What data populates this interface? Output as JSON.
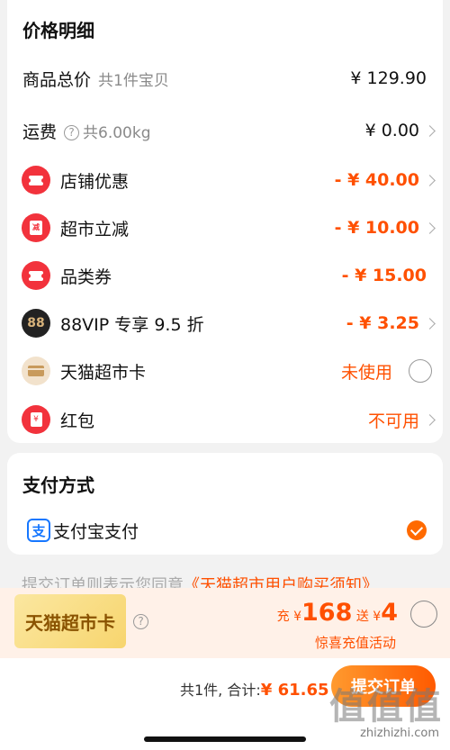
{
  "price_card": {
    "title": "价格明细",
    "rows": [
      {
        "label": "商品总价",
        "sub": "共1件宝贝",
        "value": "¥ 129.90"
      },
      {
        "label": "运费",
        "sub": "共6.00kg",
        "value": "¥ 0.00"
      },
      {
        "label": "店铺优惠",
        "value": "- ¥ 40.00",
        "icon": "shop-coupon-icon"
      },
      {
        "label": "超市立减",
        "value": "- ¥ 10.00",
        "icon": "supermarket-discount-icon",
        "icon_text": "减"
      },
      {
        "label": "品类券",
        "value": "- ¥ 15.00",
        "icon": "category-coupon-icon"
      },
      {
        "label": "88VIP 专享 9.5 折",
        "value": "- ¥ 3.25",
        "icon": "88vip-icon",
        "icon_text": "88"
      },
      {
        "label": "天猫超市卡",
        "value": "未使用",
        "icon": "tmall-card-icon"
      },
      {
        "label": "红包",
        "value": "不可用",
        "icon": "red-packet-icon",
        "icon_text": "¥"
      }
    ]
  },
  "payment": {
    "title": "支付方式",
    "method_label": "支付宝支付",
    "icon_text": "支"
  },
  "agreement": {
    "text": "提交订单则表示您同意",
    "link": "《天猫超市用户购买须知》"
  },
  "promo": {
    "badge": "天猫超市卡",
    "charge_prefix": "充",
    "currency": "¥",
    "charge_amount": "168",
    "bonus_prefix": "送",
    "bonus_amount": "4",
    "description": "惊喜充值活动"
  },
  "footer": {
    "count": "共1件,",
    "total_label": "合计:",
    "total_value": "¥ 61.65",
    "submit_label": "提交订单"
  },
  "watermark": {
    "brand": "值值值",
    "url": "zhizhizhi.com"
  },
  "colors": {
    "accent": "#ff5000",
    "coupon_red": "#f2323c",
    "alipay_blue": "#1677ff"
  }
}
